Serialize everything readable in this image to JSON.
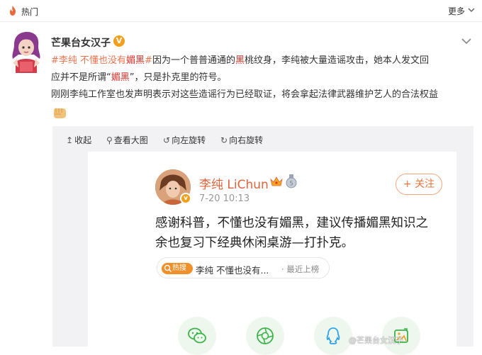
{
  "topbar": {
    "hot_label": "热门",
    "more_label": "更多"
  },
  "post": {
    "username": "芒果台女汉子",
    "vbadge": "V",
    "text": {
      "line1_tag": "#李纯 不懂也没有",
      "line1_tag_red": "媚黑",
      "line1_hash": "#",
      "line1_a": "因为一个普普通通的",
      "line1_red": "黑",
      "line1_b": "桃纹身，李纯被大量造谣攻击，她本人发文回",
      "line2_a": "应并不是所谓“",
      "line2_red": "媚黑",
      "line2_b": "”，只是扑克里的符号。",
      "line3": "刚刚李纯工作室也发声明表示对这些造谣行为已经取证，将会拿起法律武器维护艺人的合法权益"
    }
  },
  "toolbar": {
    "collapse_icon": "↥",
    "collapse": "收起",
    "large_icon": "⚲",
    "large": "查看大图",
    "rotate_left_icon": "↺",
    "rotate_left": "向左旋转",
    "rotate_right_icon": "↻",
    "rotate_right": "向右旋转"
  },
  "screenshot": {
    "name": "李纯 LiChun",
    "time": "7-20 10:13",
    "follow": "+ 关注",
    "text_line1": "感谢科普，不懂也没有媚黑，建议传播媚黑知识之",
    "text_line2": "余也复习下经典休闲桌游—打扑克。",
    "hot_badge": "热搜",
    "hot_text": "李纯 不懂也没有...",
    "hot_meta": "· 最近上榜",
    "share_icons": [
      "wechat-icon",
      "moments-icon",
      "qq-icon",
      "photo-icon"
    ]
  },
  "watermark": "@芒果台女汉子",
  "colors": {
    "tag": "#eb7350",
    "red": "#e0322a",
    "follow": "#e8743f",
    "hot": "#f0902a"
  }
}
